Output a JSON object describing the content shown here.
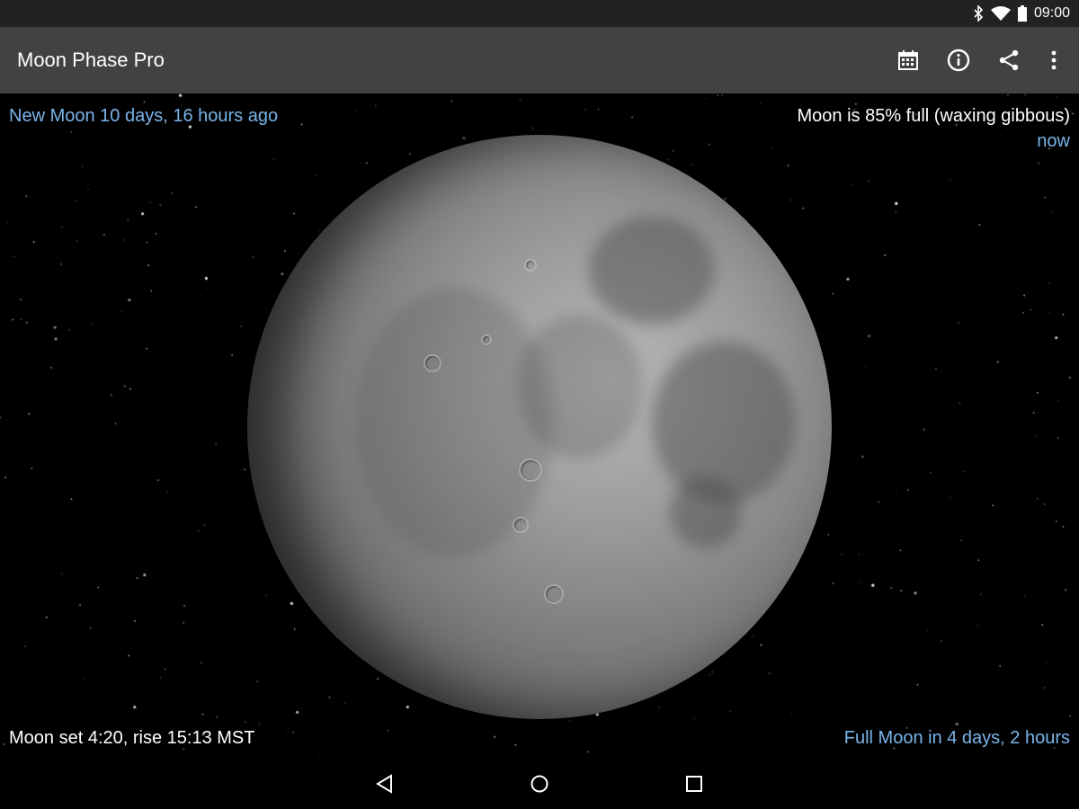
{
  "status_bar": {
    "time": "09:00",
    "icons": [
      "bluetooth-icon",
      "wifi-icon",
      "battery-icon"
    ]
  },
  "app_bar": {
    "title": "Moon Phase Pro",
    "actions": [
      "calendar-icon",
      "info-icon",
      "share-icon",
      "more-vert-icon"
    ]
  },
  "info": {
    "new_moon": "New Moon 10 days, 16 hours ago",
    "illumination": "Moon is 85% full (waxing gibbous)",
    "time_label": "now",
    "rise_set": "Moon set 4:20, rise 15:13 MST",
    "full_moon": "Full Moon in 4 days, 2 hours"
  },
  "illumination_percent": 85,
  "colors": {
    "accent": "#7ab4ea",
    "appbar": "#424242",
    "statusbar": "#222222"
  },
  "nav": [
    "back-icon",
    "home-icon",
    "recents-icon"
  ]
}
